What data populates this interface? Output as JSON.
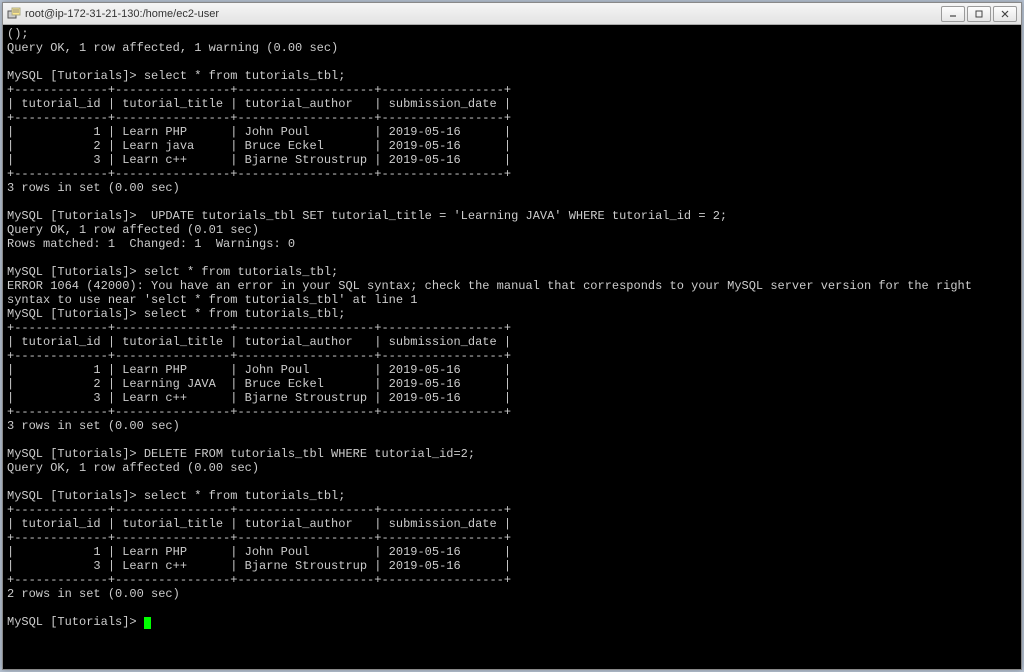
{
  "window": {
    "title": "root@ip-172-31-21-130:/home/ec2-user"
  },
  "prompt": "MySQL [Tutorials]>",
  "lines": {
    "l0": "();",
    "l1": "Query OK, 1 row affected, 1 warning (0.00 sec)",
    "blank": "",
    "cmd_select1": " select * from tutorials_tbl;",
    "tbl_border": "+-------------+----------------+-------------------+-----------------+",
    "tbl_header": "| tutorial_id | tutorial_title | tutorial_author   | submission_date |",
    "tbl1_r1": "|           1 | Learn PHP      | John Poul         | 2019-05-16      |",
    "tbl1_r2": "|           2 | Learn java     | Bruce Eckel       | 2019-05-16      |",
    "tbl1_r3": "|           3 | Learn c++      | Bjarne Stroustrup | 2019-05-16      |",
    "res3": "3 rows in set (0.00 sec)",
    "cmd_update": "  UPDATE tutorials_tbl SET tutorial_title = 'Learning JAVA' WHERE tutorial_id = 2;",
    "update_ok": "Query OK, 1 row affected (0.01 sec)",
    "update_match": "Rows matched: 1  Changed: 1  Warnings: 0",
    "cmd_selct_typo": " selct * from tutorials_tbl;",
    "err1064": "ERROR 1064 (42000): You have an error in your SQL syntax; check the manual that corresponds to your MySQL server version for the right",
    "err1064b": "syntax to use near 'selct * from tutorials_tbl' at line 1",
    "cmd_select2": " select * from tutorials_tbl;",
    "tbl2_r2": "|           2 | Learning JAVA  | Bruce Eckel       | 2019-05-16      |",
    "cmd_delete": " DELETE FROM tutorials_tbl WHERE tutorial_id=2;",
    "delete_ok": "Query OK, 1 row affected (0.00 sec)",
    "cmd_select3": " select * from tutorials_tbl;",
    "res2": "2 rows in set (0.00 sec)",
    "final_prompt": " "
  },
  "chart_data": {
    "type": "table",
    "title": "tutorials_tbl",
    "columns": [
      "tutorial_id",
      "tutorial_title",
      "tutorial_author",
      "submission_date"
    ],
    "states": [
      {
        "label": "before_update",
        "rows": [
          [
            1,
            "Learn PHP",
            "John Poul",
            "2019-05-16"
          ],
          [
            2,
            "Learn java",
            "Bruce Eckel",
            "2019-05-16"
          ],
          [
            3,
            "Learn c++",
            "Bjarne Stroustrup",
            "2019-05-16"
          ]
        ]
      },
      {
        "label": "after_update",
        "rows": [
          [
            1,
            "Learn PHP",
            "John Poul",
            "2019-05-16"
          ],
          [
            2,
            "Learning JAVA",
            "Bruce Eckel",
            "2019-05-16"
          ],
          [
            3,
            "Learn c++",
            "Bjarne Stroustrup",
            "2019-05-16"
          ]
        ]
      },
      {
        "label": "after_delete",
        "rows": [
          [
            1,
            "Learn PHP",
            "John Poul",
            "2019-05-16"
          ],
          [
            3,
            "Learn c++",
            "Bjarne Stroustrup",
            "2019-05-16"
          ]
        ]
      }
    ]
  },
  "commands": {
    "select": "select * from tutorials_tbl;",
    "update": "UPDATE tutorials_tbl SET tutorial_title = 'Learning JAVA' WHERE tutorial_id = 2;",
    "select_typo": "selct * from tutorials_tbl;",
    "delete": "DELETE FROM tutorials_tbl WHERE tutorial_id=2;"
  }
}
